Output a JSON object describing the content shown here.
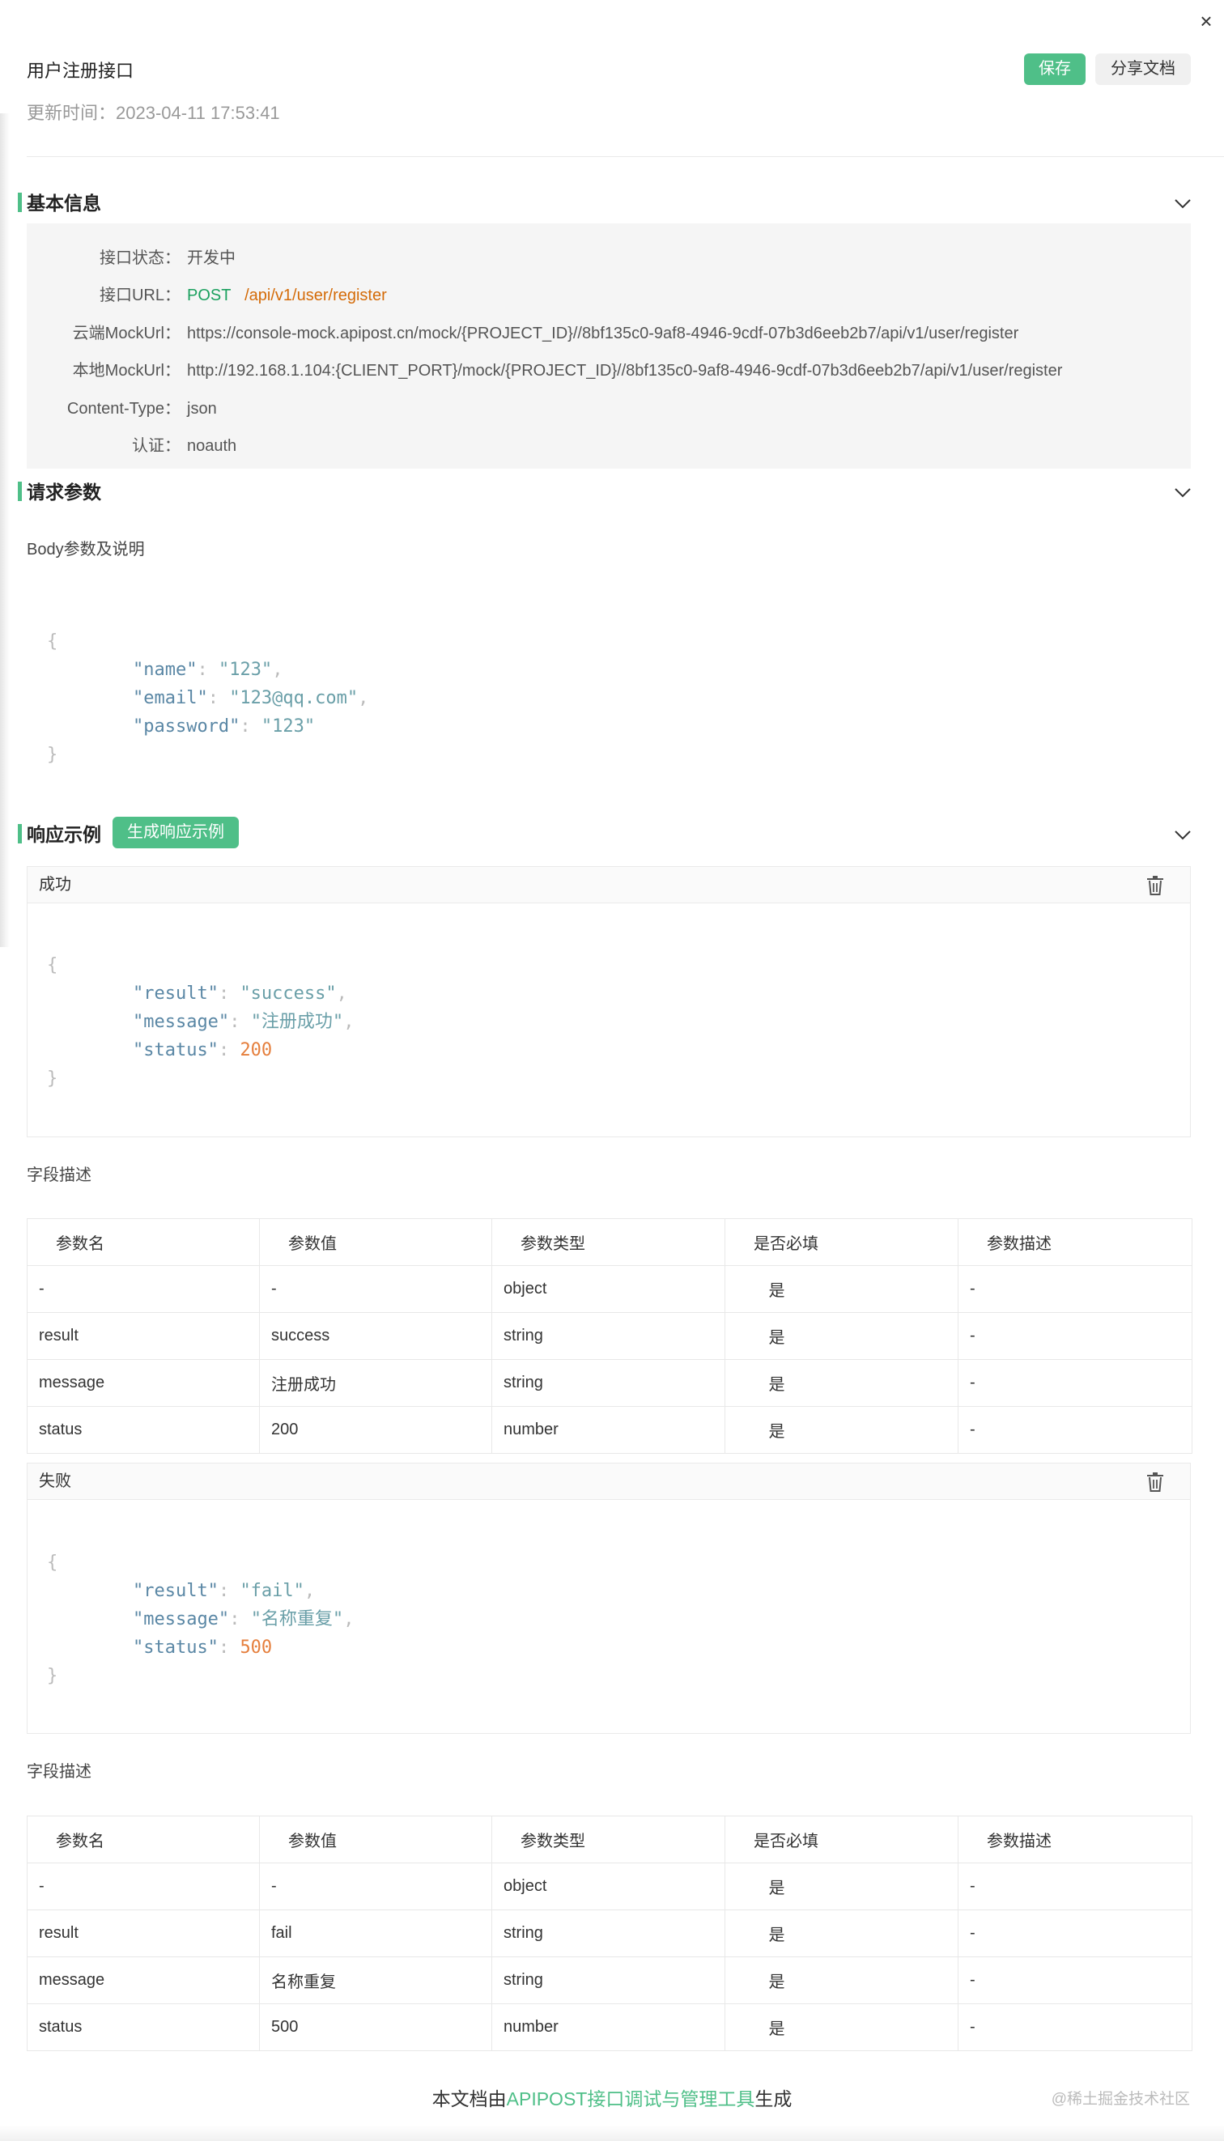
{
  "header": {
    "title": "用户注册接口",
    "updated_label": "更新时间：",
    "updated_value": "2023-04-11 17:53:41",
    "save_label": "保存",
    "share_label": "分享文档",
    "close_glyph": "×"
  },
  "basic": {
    "title": "基本信息",
    "status_key": "接口状态：",
    "status_val": "开发中",
    "url_key": "接口URL：",
    "url_method": "POST",
    "url_path": "/api/v1/user/register",
    "cloud_key": "云端MockUrl：",
    "cloud_val": "https://console-mock.apipost.cn/mock/{PROJECT_ID}//8bf135c0-9af8-4946-9cdf-07b3d6eeb2b7/api/v1/user/register",
    "local_key": "本地MockUrl：",
    "local_val": "http://192.168.1.104:{CLIENT_PORT}/mock/{PROJECT_ID}//8bf135c0-9af8-4946-9cdf-07b3d6eeb2b7/api/v1/user/register",
    "ctype_key": "Content-Type：",
    "ctype_val": "json",
    "auth_key": "认证：",
    "auth_val": "noauth"
  },
  "request": {
    "title": "请求参数",
    "body_label": "Body参数及说明",
    "fields": [
      {
        "key": "\"name\"",
        "value": "\"123\"",
        "trail": ","
      },
      {
        "key": "\"email\"",
        "value": "\"123@qq.com\"",
        "trail": ","
      },
      {
        "key": "\"password\"",
        "value": "\"123\"",
        "trail": ""
      }
    ]
  },
  "response": {
    "title": "响应示例",
    "generate_label": "生成响应示例",
    "field_desc_label": "字段描述",
    "columns": [
      "参数名",
      "参数值",
      "参数类型",
      "是否必填",
      "参数描述"
    ],
    "examples": [
      {
        "name": "成功",
        "json": [
          {
            "key": "\"result\"",
            "value": "\"success\"",
            "trail": ",",
            "kind": "str"
          },
          {
            "key": "\"message\"",
            "value": "\"注册成功\"",
            "trail": ",",
            "kind": "str"
          },
          {
            "key": "\"status\"",
            "value": "200",
            "trail": "",
            "kind": "num"
          }
        ],
        "rows": [
          [
            "-",
            "-",
            "object",
            "是",
            "-"
          ],
          [
            "result",
            "success",
            "string",
            "是",
            "-"
          ],
          [
            "message",
            "注册成功",
            "string",
            "是",
            "-"
          ],
          [
            "status",
            "200",
            "number",
            "是",
            "-"
          ]
        ]
      },
      {
        "name": "失败",
        "json": [
          {
            "key": "\"result\"",
            "value": "\"fail\"",
            "trail": ",",
            "kind": "str"
          },
          {
            "key": "\"message\"",
            "value": "\"名称重复\"",
            "trail": ",",
            "kind": "str"
          },
          {
            "key": "\"status\"",
            "value": "500",
            "trail": "",
            "kind": "num"
          }
        ],
        "rows": [
          [
            "-",
            "-",
            "object",
            "是",
            "-"
          ],
          [
            "result",
            "fail",
            "string",
            "是",
            "-"
          ],
          [
            "message",
            "名称重复",
            "string",
            "是",
            "-"
          ],
          [
            "status",
            "500",
            "number",
            "是",
            "-"
          ]
        ]
      }
    ]
  },
  "footer": {
    "prefix": "本文档由",
    "link": "APIPOST接口调试与管理工具",
    "suffix": "生成",
    "watermark": "@稀土掘金技术社区"
  },
  "colors": {
    "accent": "#4fbf88",
    "url_orange": "#d46b08",
    "method_green": "#1aa05e"
  },
  "icons": {
    "close": "close-icon",
    "collapse": "chevron-down-icon",
    "delete": "trash-icon"
  }
}
